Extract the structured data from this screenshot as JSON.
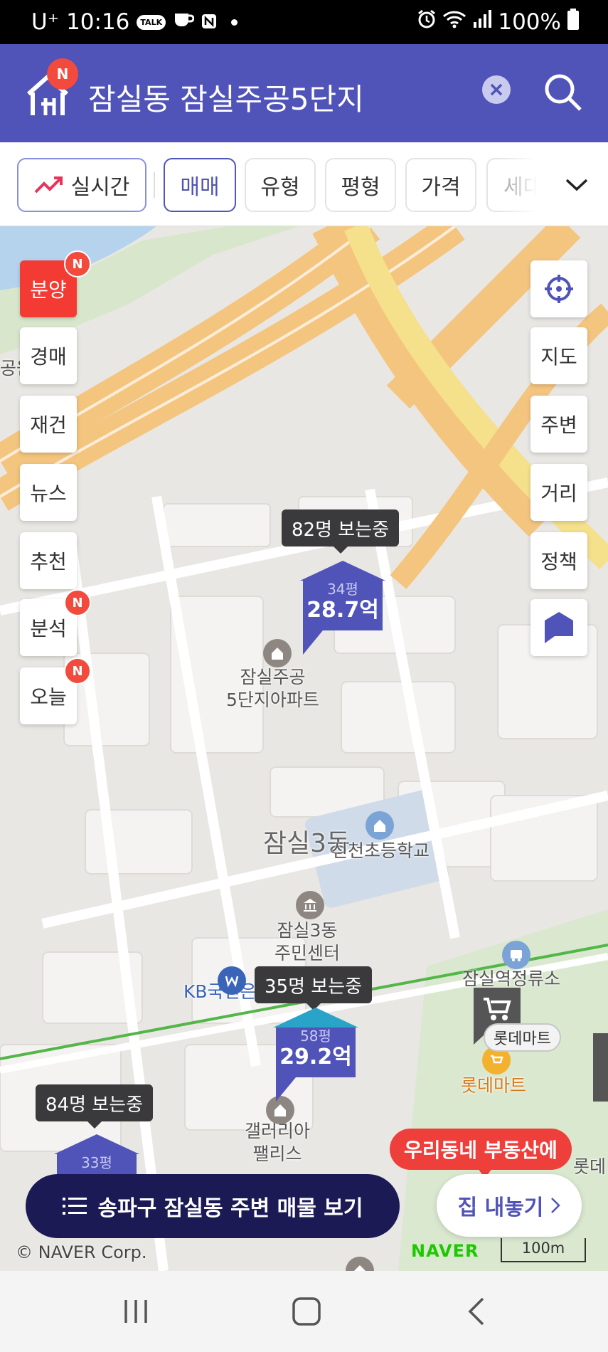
{
  "status_bar": {
    "carrier": "U⁺",
    "time": "10:16",
    "talk_badge": "TALK",
    "battery": "100%"
  },
  "header": {
    "search_query": "잠실동 잠실주공5단지",
    "logo_badge": "N",
    "accent_color": "#5053b8"
  },
  "filters": {
    "realtime_label": "실시간",
    "items": [
      "매매",
      "유형",
      "평형",
      "가격",
      "세대"
    ]
  },
  "left_menu": [
    {
      "label": "분양",
      "badge": "N",
      "highlighted": true
    },
    {
      "label": "경매",
      "badge": ""
    },
    {
      "label": "재건",
      "badge": ""
    },
    {
      "label": "뉴스",
      "badge": ""
    },
    {
      "label": "추천",
      "badge": ""
    },
    {
      "label": "분석",
      "badge": "N"
    },
    {
      "label": "오늘",
      "badge": "N"
    }
  ],
  "right_menu": [
    "지도",
    "주변",
    "거리",
    "정책"
  ],
  "markers": [
    {
      "viewers": "82명 보는중",
      "area": "34평",
      "price": "28.7억"
    },
    {
      "viewers": "35명 보는중",
      "area": "58평",
      "price": "29.2억"
    },
    {
      "viewers": "84명 보는중",
      "area": "33평",
      "price": ""
    }
  ],
  "map_labels": {
    "edge_park": "공원",
    "apartment": "잠실주공\n5단지아파트",
    "district": "잠실3동",
    "school": "신천초등학교",
    "community_center": "잠실3동\n주민센터",
    "bank": "KB국민은행",
    "bus_stop": "잠실역정류소",
    "mart_bubble": "롯데마트",
    "mart": "롯데마트",
    "gallery": "갤러리아\n팰리스",
    "edge_right": "롯데"
  },
  "bottom": {
    "cta_label": "송파구 잠실동 주변 매물 보기",
    "promo_label": "우리동네 부동산에",
    "list_home_label": "집 내놓기",
    "copyright": "© NAVER Corp.",
    "naver_logo": "NAVER",
    "scale": "100m"
  }
}
